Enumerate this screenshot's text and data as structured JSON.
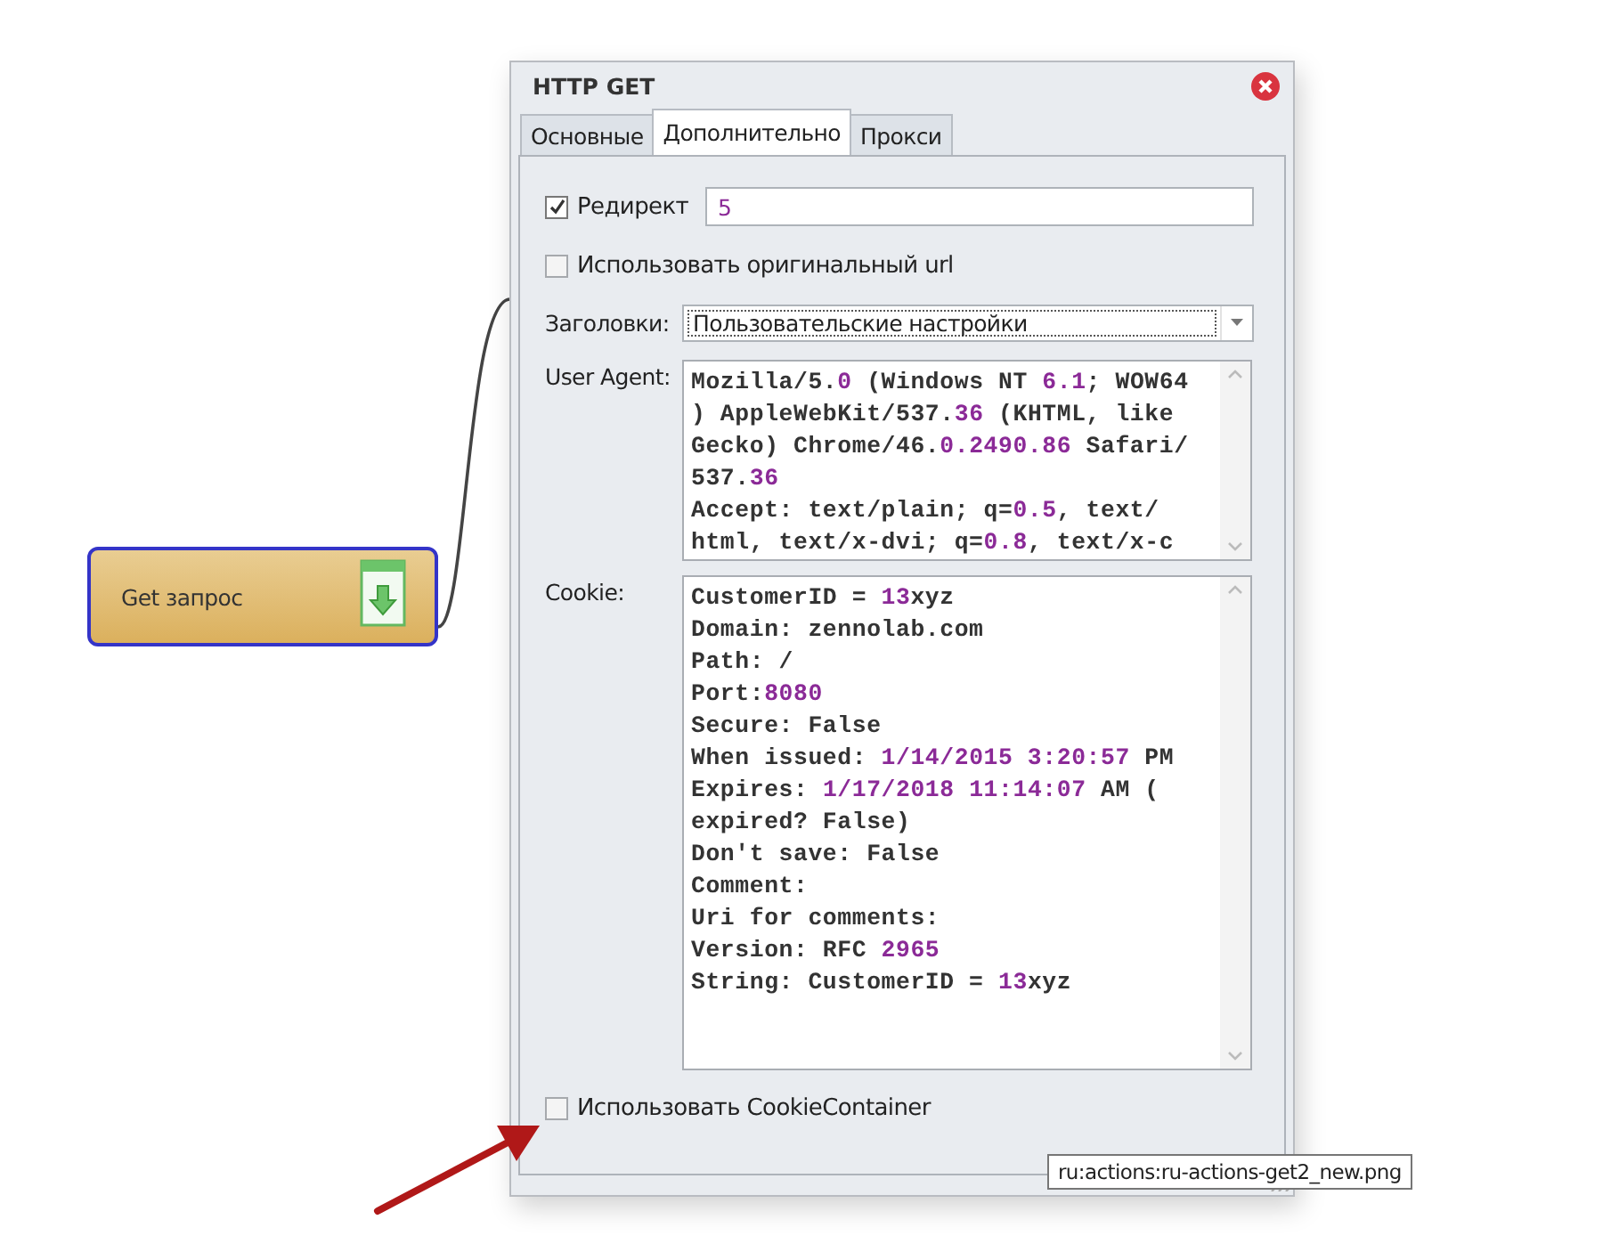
{
  "node": {
    "label": "Get запрос"
  },
  "dialog": {
    "title": "HTTP GET",
    "tabs": [
      {
        "label": "Основные",
        "selected": false
      },
      {
        "label": "Дополнительно",
        "selected": true
      },
      {
        "label": "Прокси",
        "selected": false
      }
    ],
    "redirect": {
      "label": "Редирект",
      "checked": true,
      "value": "5"
    },
    "original_url": {
      "label": "Использовать оригинальный url",
      "checked": false
    },
    "headers": {
      "label": "Заголовки:",
      "value": "Пользовательские настройки"
    },
    "user_agent": {
      "label": "User Agent:",
      "lines": [
        {
          "segments": [
            {
              "text": "Mozilla/5.",
              "number": false
            },
            {
              "text": "0",
              "number": true
            },
            {
              "text": " (Windows NT ",
              "number": false
            },
            {
              "text": "6.1",
              "number": true
            },
            {
              "text": "; WOW64",
              "number": false
            }
          ]
        },
        {
          "segments": [
            {
              "text": ") AppleWebKit/537.",
              "number": false
            },
            {
              "text": "36",
              "number": true
            },
            {
              "text": " (KHTML, like",
              "number": false
            }
          ]
        },
        {
          "segments": [
            {
              "text": "Gecko) Chrome/46.",
              "number": false
            },
            {
              "text": "0.2490.86",
              "number": true
            },
            {
              "text": " Safari/",
              "number": false
            }
          ]
        },
        {
          "segments": [
            {
              "text": "537.",
              "number": false
            },
            {
              "text": "36",
              "number": true
            }
          ]
        },
        {
          "segments": [
            {
              "text": "Accept: text/plain; q=",
              "number": false
            },
            {
              "text": "0.5",
              "number": true
            },
            {
              "text": ", text/",
              "number": false
            }
          ]
        },
        {
          "segments": [
            {
              "text": "html, text/x-dvi; q=",
              "number": false
            },
            {
              "text": "0.8",
              "number": true
            },
            {
              "text": ", text/x-c",
              "number": false
            }
          ]
        }
      ]
    },
    "cookie": {
      "label": "Cookie:",
      "lines": [
        {
          "segments": [
            {
              "text": "CustomerID = ",
              "number": false
            },
            {
              "text": "13",
              "number": true
            },
            {
              "text": "xyz",
              "number": false
            }
          ]
        },
        {
          "segments": [
            {
              "text": "Domain: zennolab.com",
              "number": false
            }
          ]
        },
        {
          "segments": [
            {
              "text": "Path: /",
              "number": false
            }
          ]
        },
        {
          "segments": [
            {
              "text": "Port:",
              "number": false
            },
            {
              "text": "8080",
              "number": true
            }
          ]
        },
        {
          "segments": [
            {
              "text": "Secure: False",
              "number": false
            }
          ]
        },
        {
          "segments": [
            {
              "text": "When issued: ",
              "number": false
            },
            {
              "text": "1/14/2015",
              "number": true
            },
            {
              "text": " 3:20:57",
              "number": true
            },
            {
              "text": " PM",
              "number": false
            }
          ]
        },
        {
          "segments": [
            {
              "text": "Expires: ",
              "number": false
            },
            {
              "text": "1/17/2018",
              "number": true
            },
            {
              "text": " 11:14:07",
              "number": true
            },
            {
              "text": " AM (",
              "number": false
            }
          ]
        },
        {
          "segments": [
            {
              "text": "expired? False)",
              "number": false
            }
          ]
        },
        {
          "segments": [
            {
              "text": "Don't save: False",
              "number": false
            }
          ]
        },
        {
          "segments": [
            {
              "text": "Comment:",
              "number": false
            }
          ]
        },
        {
          "segments": [
            {
              "text": "Uri for comments:",
              "number": false
            }
          ]
        },
        {
          "segments": [
            {
              "text": "Version: RFC ",
              "number": false
            },
            {
              "text": "2965",
              "number": true
            }
          ]
        },
        {
          "segments": [
            {
              "text": "String: CustomerID = ",
              "number": false
            },
            {
              "text": "13",
              "number": true
            },
            {
              "text": "xyz",
              "number": false
            }
          ]
        }
      ]
    },
    "cookie_container": {
      "label": "Использовать CookieContainer",
      "checked": false
    }
  },
  "tooltip": "ru:actions:ru-actions-get2_new.png"
}
